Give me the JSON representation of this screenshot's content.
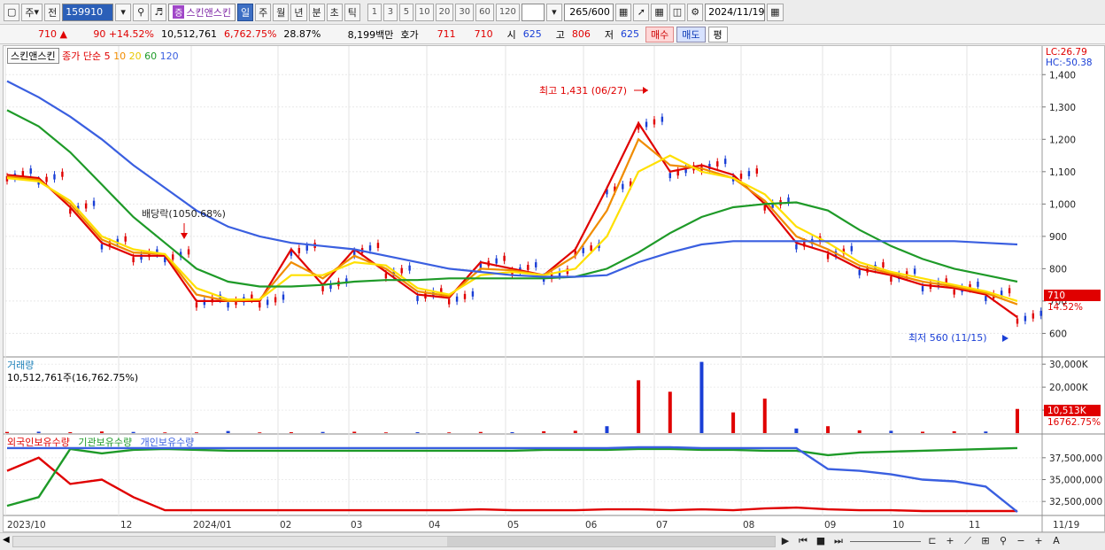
{
  "toolbar": {
    "period_main": "주",
    "prev_label": "전",
    "stock_code": "159910",
    "stock_badge": "증",
    "stock_name": "스킨앤스킨",
    "tabs": [
      "일",
      "주",
      "월",
      "년",
      "분",
      "초",
      "틱"
    ],
    "active_tab_index": 0,
    "interval_buttons": [
      "1",
      "3",
      "5",
      "10",
      "20",
      "30",
      "60",
      "120"
    ],
    "count_value": "265",
    "count_total": "/600",
    "date_value": "2024/11/19"
  },
  "quote": {
    "price": "710",
    "change": "90",
    "change_rate": "+14.52%",
    "volume": "10,512,761",
    "volume_rate": "6,762.75%",
    "turnover": "28.87%",
    "amount": "8,199백만",
    "ask_label": "호가",
    "ask_value": "711",
    "bid_value": "710",
    "open_label": "시",
    "open_value": "625",
    "high_label": "고",
    "high_value": "806",
    "low_label": "저",
    "low_value": "625",
    "buy_button": "매수",
    "sell_button": "매도",
    "eval_button": "평"
  },
  "price_panel": {
    "legend_name": "스킨앤스킨",
    "legend_label": "종가 단순",
    "ma_labels": [
      "5",
      "10",
      "20",
      "60",
      "120"
    ],
    "ma_colors": [
      "#e00000",
      "#f08c00",
      "#ffe000",
      "#1e9a28",
      "#3a5fe0"
    ],
    "lc_label": "LC:26.79",
    "hc_label": "HC:-50.38",
    "high_annotation": "최고 1,431 (06/27)",
    "low_annotation": "최저 560 (11/15)",
    "dividend_annotation": "배당락(1050.68%)",
    "current_price_tag": "710",
    "current_rate_tag": "14.52%"
  },
  "volume_panel": {
    "title": "거래량",
    "detail": "10,512,761주(16,762.75%)",
    "current_tag": "10,513K",
    "rate_tag": "16762.75%"
  },
  "holding_panel": {
    "legend": [
      "외국인보유수량",
      "기관보유수량",
      "개인보유수량"
    ],
    "legend_colors": [
      "#e00000",
      "#1e9a28",
      "#3a5fe0"
    ]
  },
  "x_axis_labels": [
    "2023/10",
    "12",
    "2024/01",
    "02",
    "03",
    "04",
    "05",
    "06",
    "07",
    "08",
    "09",
    "10",
    "11",
    "11/19"
  ],
  "chart_data": {
    "type": "line",
    "title": "",
    "price_axis": {
      "ticks": [
        600,
        700,
        800,
        900,
        1000,
        1100,
        1200,
        1300,
        1400
      ],
      "labels": [
        "600",
        "700",
        "800",
        "900",
        "1,000",
        "1,100",
        "1,200",
        "1,300",
        "1,400"
      ],
      "ylim": [
        530,
        1450
      ]
    },
    "volume_axis": {
      "labels": [
        "10,000K",
        "20,000K",
        "30,000K"
      ],
      "ticks": [
        10000,
        20000,
        30000
      ],
      "ylim": [
        0,
        32000
      ]
    },
    "holding_axis": {
      "labels": [
        "32,500,000",
        "35,000,000",
        "37,500,000"
      ],
      "ticks": [
        32500000,
        35000000,
        37500000
      ]
    },
    "x": [
      "2023/10",
      "12",
      "2024/01",
      "02",
      "03",
      "04",
      "05",
      "06",
      "07",
      "08",
      "09",
      "10",
      "11",
      "11/19"
    ],
    "series": [
      {
        "name": "5",
        "color": "#e00000",
        "values": [
          1090,
          1080,
          990,
          880,
          840,
          840,
          700,
          700,
          700,
          860,
          750,
          860,
          790,
          720,
          710,
          820,
          800,
          780,
          860,
          1050,
          1250,
          1100,
          1120,
          1090,
          1000,
          880,
          850,
          800,
          780,
          750,
          740,
          720,
          650
        ]
      },
      {
        "name": "10",
        "color": "#f08c00",
        "values": [
          1085,
          1075,
          1000,
          890,
          850,
          845,
          720,
          700,
          705,
          820,
          770,
          840,
          800,
          730,
          715,
          800,
          795,
          780,
          840,
          980,
          1200,
          1120,
          1110,
          1080,
          1010,
          900,
          860,
          810,
          785,
          760,
          745,
          725,
          690
        ]
      },
      {
        "name": "20",
        "color": "#ffe000",
        "values": [
          1080,
          1070,
          1010,
          900,
          860,
          845,
          740,
          705,
          705,
          780,
          780,
          820,
          810,
          740,
          720,
          780,
          790,
          780,
          800,
          900,
          1100,
          1150,
          1100,
          1080,
          1030,
          930,
          880,
          820,
          790,
          770,
          750,
          730,
          700
        ]
      },
      {
        "name": "60",
        "color": "#1e9a28",
        "values": [
          1290,
          1240,
          1160,
          1060,
          960,
          880,
          800,
          760,
          745,
          745,
          750,
          760,
          765,
          765,
          770,
          770,
          770,
          770,
          775,
          800,
          850,
          910,
          960,
          990,
          1000,
          1005,
          980,
          920,
          870,
          830,
          800,
          780,
          760
        ]
      },
      {
        "name": "120",
        "color": "#3a5fe0",
        "values": [
          1380,
          1330,
          1270,
          1200,
          1120,
          1050,
          980,
          930,
          900,
          880,
          870,
          860,
          840,
          820,
          800,
          790,
          780,
          775,
          775,
          780,
          820,
          850,
          875,
          885,
          885,
          885,
          885,
          885,
          885,
          885,
          885,
          880,
          875
        ]
      }
    ],
    "volume_bars": [
      500,
      600,
      400,
      700,
      500,
      300,
      300,
      900,
      300,
      400,
      500,
      600,
      300,
      400,
      300,
      500,
      400,
      800,
      1000,
      3000,
      23000,
      18000,
      31000,
      9000,
      15000,
      2000,
      3000,
      1200,
      1000,
      600,
      800,
      700,
      10513
    ],
    "holding_series": [
      {
        "name": "외국인보유수량",
        "color": "#e00000",
        "values": [
          36000000,
          37500000,
          34500000,
          35000000,
          33000000,
          31500000,
          31500000,
          31500000,
          31500000,
          31500000,
          31500000,
          31500000,
          31500000,
          31500000,
          31500000,
          31600000,
          31500000,
          31500000,
          31500000,
          31600000,
          31600000,
          31500000,
          31600000,
          31500000,
          31700000,
          31800000,
          31600000,
          31500000,
          31500000,
          31400000,
          31400000,
          31400000,
          31400000
        ]
      },
      {
        "name": "기관보유수량",
        "color": "#1e9a28",
        "values": [
          32000000,
          33000000,
          38500000,
          38000000,
          38400000,
          38500000,
          38400000,
          38300000,
          38300000,
          38300000,
          38300000,
          38300000,
          38300000,
          38300000,
          38300000,
          38300000,
          38300000,
          38400000,
          38400000,
          38400000,
          38500000,
          38500000,
          38400000,
          38400000,
          38300000,
          38300000,
          37800000,
          38100000,
          38200000,
          38300000,
          38400000,
          38500000,
          38600000
        ]
      },
      {
        "name": "개인보유수량",
        "color": "#3a5fe0",
        "values": [
          38600000,
          38600000,
          38600000,
          38600000,
          38600000,
          38600000,
          38600000,
          38600000,
          38600000,
          38600000,
          38600000,
          38600000,
          38600000,
          38600000,
          38600000,
          38600000,
          38600000,
          38600000,
          38600000,
          38600000,
          38700000,
          38700000,
          38600000,
          38600000,
          38600000,
          38600000,
          36200000,
          36000000,
          35600000,
          35000000,
          34800000,
          34200000,
          31300000
        ]
      }
    ]
  }
}
